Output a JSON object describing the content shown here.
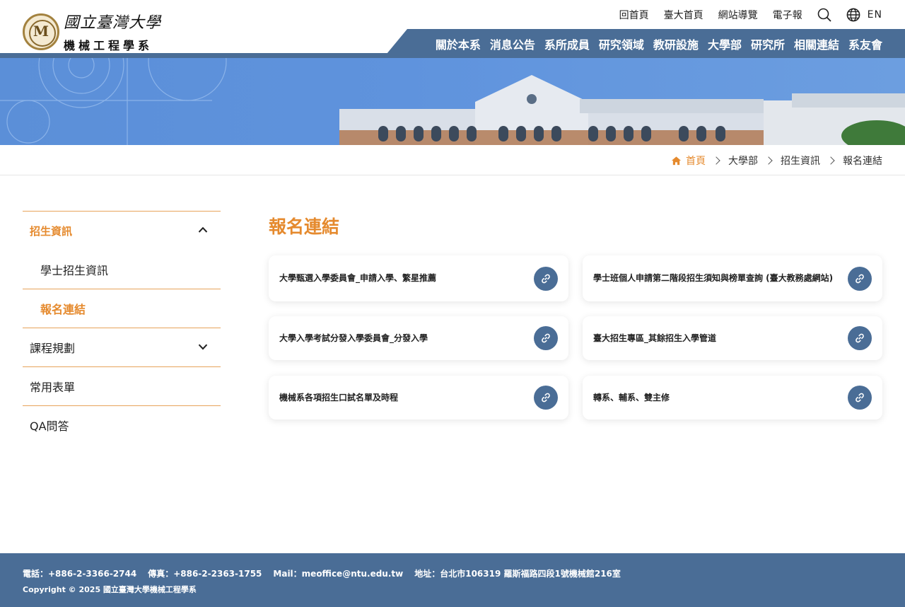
{
  "header": {
    "logo_university": "國立臺灣大學",
    "logo_department": "機械工程學系",
    "top_links": [
      "回首頁",
      "臺大首頁",
      "網站導覽",
      "電子報"
    ],
    "search_icon": "search-icon",
    "globe_icon": "globe-icon",
    "language": "EN"
  },
  "nav": {
    "items": [
      "關於本系",
      "消息公告",
      "系所成員",
      "研究領域",
      "教研設施",
      "大學部",
      "研究所",
      "相關連結",
      "系友會"
    ]
  },
  "breadcrumb": {
    "home": "首頁",
    "items": [
      "大學部",
      "招生資訊",
      "報名連結"
    ]
  },
  "sidebar": {
    "section_label": "招生資訊",
    "sub_items": [
      "學士招生資訊",
      "報名連結"
    ],
    "other_items": [
      "課程規劃",
      "常用表單",
      "QA問答"
    ]
  },
  "main": {
    "title": "報名連結",
    "cards": [
      "大學甄選入學委員會_申請入學、繁星推薦",
      "學士班個人申請第二階段招生須知與榜單查詢 (臺大教務處網站)",
      "大學入學考試分發入學委員會_分發入學",
      "臺大招生專區_其餘招生入學管道",
      "機械系各項招生口試名單及時程",
      "轉系、輔系、雙主修"
    ]
  },
  "footer": {
    "phone": "電話：+886-2-3366-2744",
    "fax": "傳真：+886-2-2363-1755",
    "mail": "Mail：meoffice@ntu.edu.tw",
    "address": "地址：台北市106319 羅斯福路四段1號機械館216室",
    "copyright": "Copyright © 2025 國立臺灣大學機械工程學系"
  },
  "colors": {
    "accent_orange": "#e58a2e",
    "brand_blue": "#4a6d96"
  }
}
